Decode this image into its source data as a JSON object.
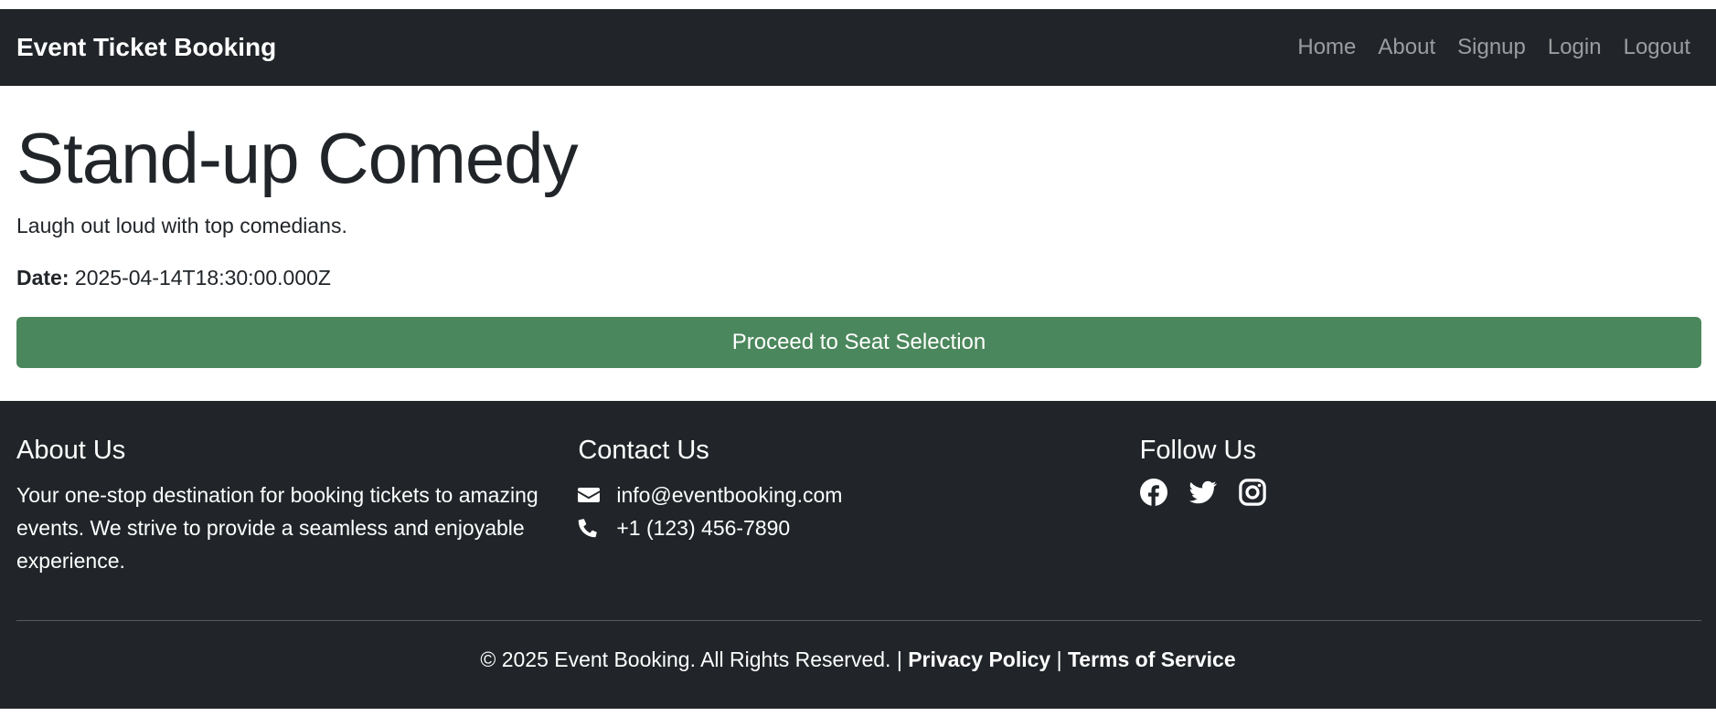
{
  "navbar": {
    "brand": "Event Ticket Booking",
    "links": [
      "Home",
      "About",
      "Signup",
      "Login",
      "Logout"
    ]
  },
  "event": {
    "title": "Stand-up Comedy",
    "description": "Laugh out loud with top comedians.",
    "date_label": "Date:",
    "date_value": "2025-04-14T18:30:00.000Z",
    "proceed_label": "Proceed to Seat Selection"
  },
  "footer": {
    "about": {
      "heading": "About Us",
      "text": "Your one-stop destination for booking tickets to amazing events. We strive to provide a seamless and enjoyable experience."
    },
    "contact": {
      "heading": "Contact Us",
      "email": "info@eventbooking.com",
      "phone": "+1 (123) 456-7890",
      "email_icon": "envelope-icon",
      "phone_icon": "phone-icon"
    },
    "follow": {
      "heading": "Follow Us",
      "icons": [
        "facebook-icon",
        "twitter-icon",
        "instagram-icon"
      ]
    },
    "copyright": "© 2025 Event Booking. All Rights Reserved. |",
    "separator": "|",
    "privacy": "Privacy Policy",
    "terms": "Terms of Service"
  },
  "colors": {
    "navbar_bg": "#212529",
    "button_green": "#4b875c",
    "nav_link": "rgba(255,255,255,0.55)"
  }
}
